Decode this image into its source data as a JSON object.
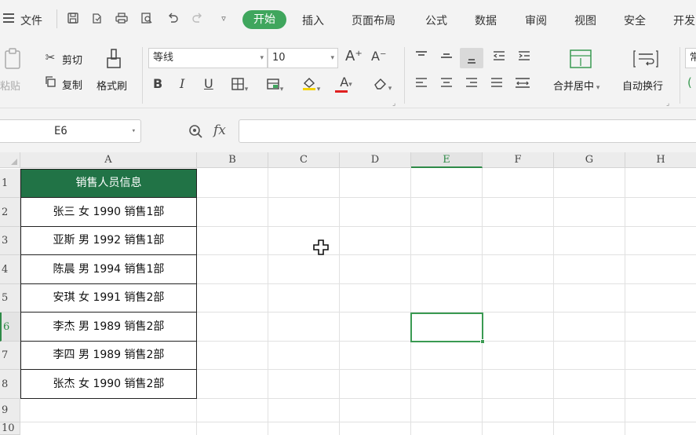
{
  "menubar": {
    "file_label": "文件",
    "tabs": [
      "开始",
      "插入",
      "页面布局",
      "公式",
      "数据",
      "审阅",
      "视图",
      "安全",
      "开发"
    ],
    "active_tab": "开始"
  },
  "ribbon": {
    "paste_label": "粘贴",
    "cut_label": "剪切",
    "copy_label": "复制",
    "format_painter_label": "格式刷",
    "font_name": "等线",
    "font_size": "10",
    "bold": "B",
    "italic": "I",
    "underline": "U",
    "font_color_letter": "A",
    "grow_font": "A⁺",
    "shrink_font": "A⁻",
    "merge_center_label": "合并居中",
    "wrap_text_label": "自动换行",
    "next_group_hint": "常"
  },
  "formula_bar": {
    "name_box": "E6",
    "fx_label": "fx",
    "formula": ""
  },
  "sheet": {
    "columns": [
      "A",
      "B",
      "C",
      "D",
      "E",
      "F",
      "G",
      "H"
    ],
    "rows": [
      "1",
      "2",
      "3",
      "4",
      "5",
      "6",
      "7",
      "8",
      "9",
      "10"
    ],
    "active_cell": "E6",
    "a_column": [
      "销售人员信息",
      "张三 女 1990 销售1部",
      "亚斯 男 1992 销售1部",
      "陈晨 男 1994 销售1部",
      "安琪 女 1991 销售2部",
      "李杰 男 1989 销售2部",
      "李四 男 1989 销售2部",
      "张杰 女 1990 销售2部"
    ]
  },
  "colors": {
    "accent": "#3fa65d",
    "header_fill": "#217346",
    "selection": "#3a9a52"
  }
}
